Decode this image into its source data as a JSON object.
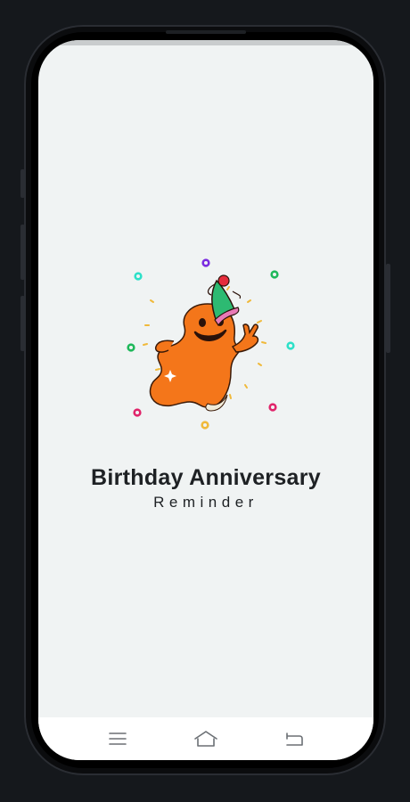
{
  "app": {
    "title": "Birthday Anniversary",
    "subtitle": "Reminder"
  },
  "illustration": {
    "name": "party-ghost-mascot",
    "colors": {
      "ghost": "#f4761a",
      "hat": "#2dba72",
      "hat_band": "#e87ab6",
      "pom": "#e52d3c"
    }
  },
  "confetti_colors": [
    "#2de0c8",
    "#7a2be0",
    "#1fb85a",
    "#e0246a",
    "#f0b93a"
  ],
  "navbar": {
    "buttons": [
      {
        "name": "menu",
        "icon": "hamburger-icon"
      },
      {
        "name": "home",
        "icon": "home-icon"
      },
      {
        "name": "back",
        "icon": "back-icon"
      }
    ]
  },
  "theme": {
    "background": "#f0f3f3",
    "text": "#1e2124",
    "navbar": "#ffffff"
  }
}
